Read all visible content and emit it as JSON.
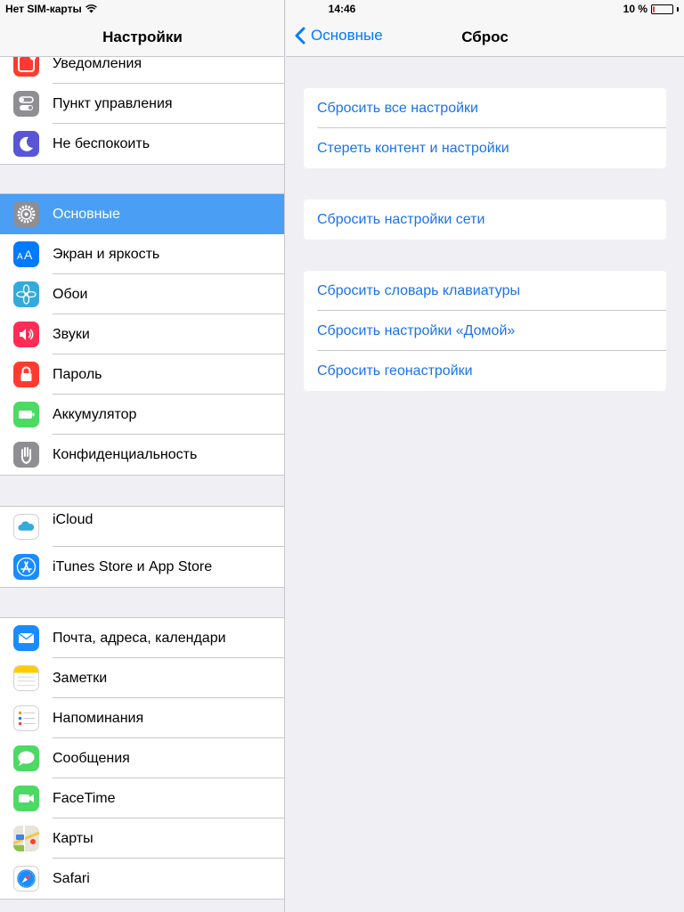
{
  "status_bar": {
    "carrier": "Нет SIM-карты",
    "time": "14:46",
    "battery_text": "10 %",
    "battery_level": 0.1
  },
  "sidebar": {
    "title": "Настройки",
    "groups": [
      [
        {
          "label": "Уведомления",
          "icon": "notifications-icon",
          "color": "#ff3b30"
        },
        {
          "label": "Пункт управления",
          "icon": "control-center-icon",
          "color": "#8e8e93"
        },
        {
          "label": "Не беспокоить",
          "icon": "moon-icon",
          "color": "#5856d6"
        }
      ],
      [
        {
          "label": "Основные",
          "icon": "gear-icon",
          "color": "#8e8e93",
          "selected": true
        },
        {
          "label": "Экран и яркость",
          "icon": "display-brightness-icon",
          "color": "#007aff"
        },
        {
          "label": "Обои",
          "icon": "wallpaper-flower-icon",
          "color": "#34aadc"
        },
        {
          "label": "Звуки",
          "icon": "speaker-icon",
          "color": "#ff2d55"
        },
        {
          "label": "Пароль",
          "icon": "lock-icon",
          "color": "#ff3b30"
        },
        {
          "label": "Аккумулятор",
          "icon": "battery-icon",
          "color": "#4cd964"
        },
        {
          "label": "Конфиденциальность",
          "icon": "hand-icon",
          "color": "#8e8e93"
        }
      ],
      [
        {
          "label": "iCloud",
          "icon": "cloud-icon",
          "color": "#ffffff"
        },
        {
          "label": "iTunes Store и App Store",
          "icon": "app-store-icon",
          "color": "#1a8cff"
        }
      ],
      [
        {
          "label": "Почта, адреса, календари",
          "icon": "mail-icon",
          "color": "#1a8cff"
        },
        {
          "label": "Заметки",
          "icon": "notes-icon",
          "color": "#ffcc00"
        },
        {
          "label": "Напоминания",
          "icon": "reminders-icon",
          "color": "#ffffff"
        },
        {
          "label": "Сообщения",
          "icon": "messages-icon",
          "color": "#4cd964"
        },
        {
          "label": "FaceTime",
          "icon": "facetime-icon",
          "color": "#4cd964"
        },
        {
          "label": "Карты",
          "icon": "maps-icon",
          "color": "#e8e4d8"
        },
        {
          "label": "Safari",
          "icon": "safari-icon",
          "color": "#ffffff"
        }
      ]
    ]
  },
  "main": {
    "back_label": "Основные",
    "title": "Сброс",
    "groups": [
      [
        "Сбросить все настройки",
        "Стереть контент и настройки"
      ],
      [
        "Сбросить настройки сети"
      ],
      [
        "Сбросить словарь клавиатуры",
        "Сбросить настройки «Домой»",
        "Сбросить геонастройки"
      ]
    ]
  },
  "colors": {
    "accent": "#007aff",
    "selected_row": "#4a9ff5",
    "background": "#efeff4"
  }
}
